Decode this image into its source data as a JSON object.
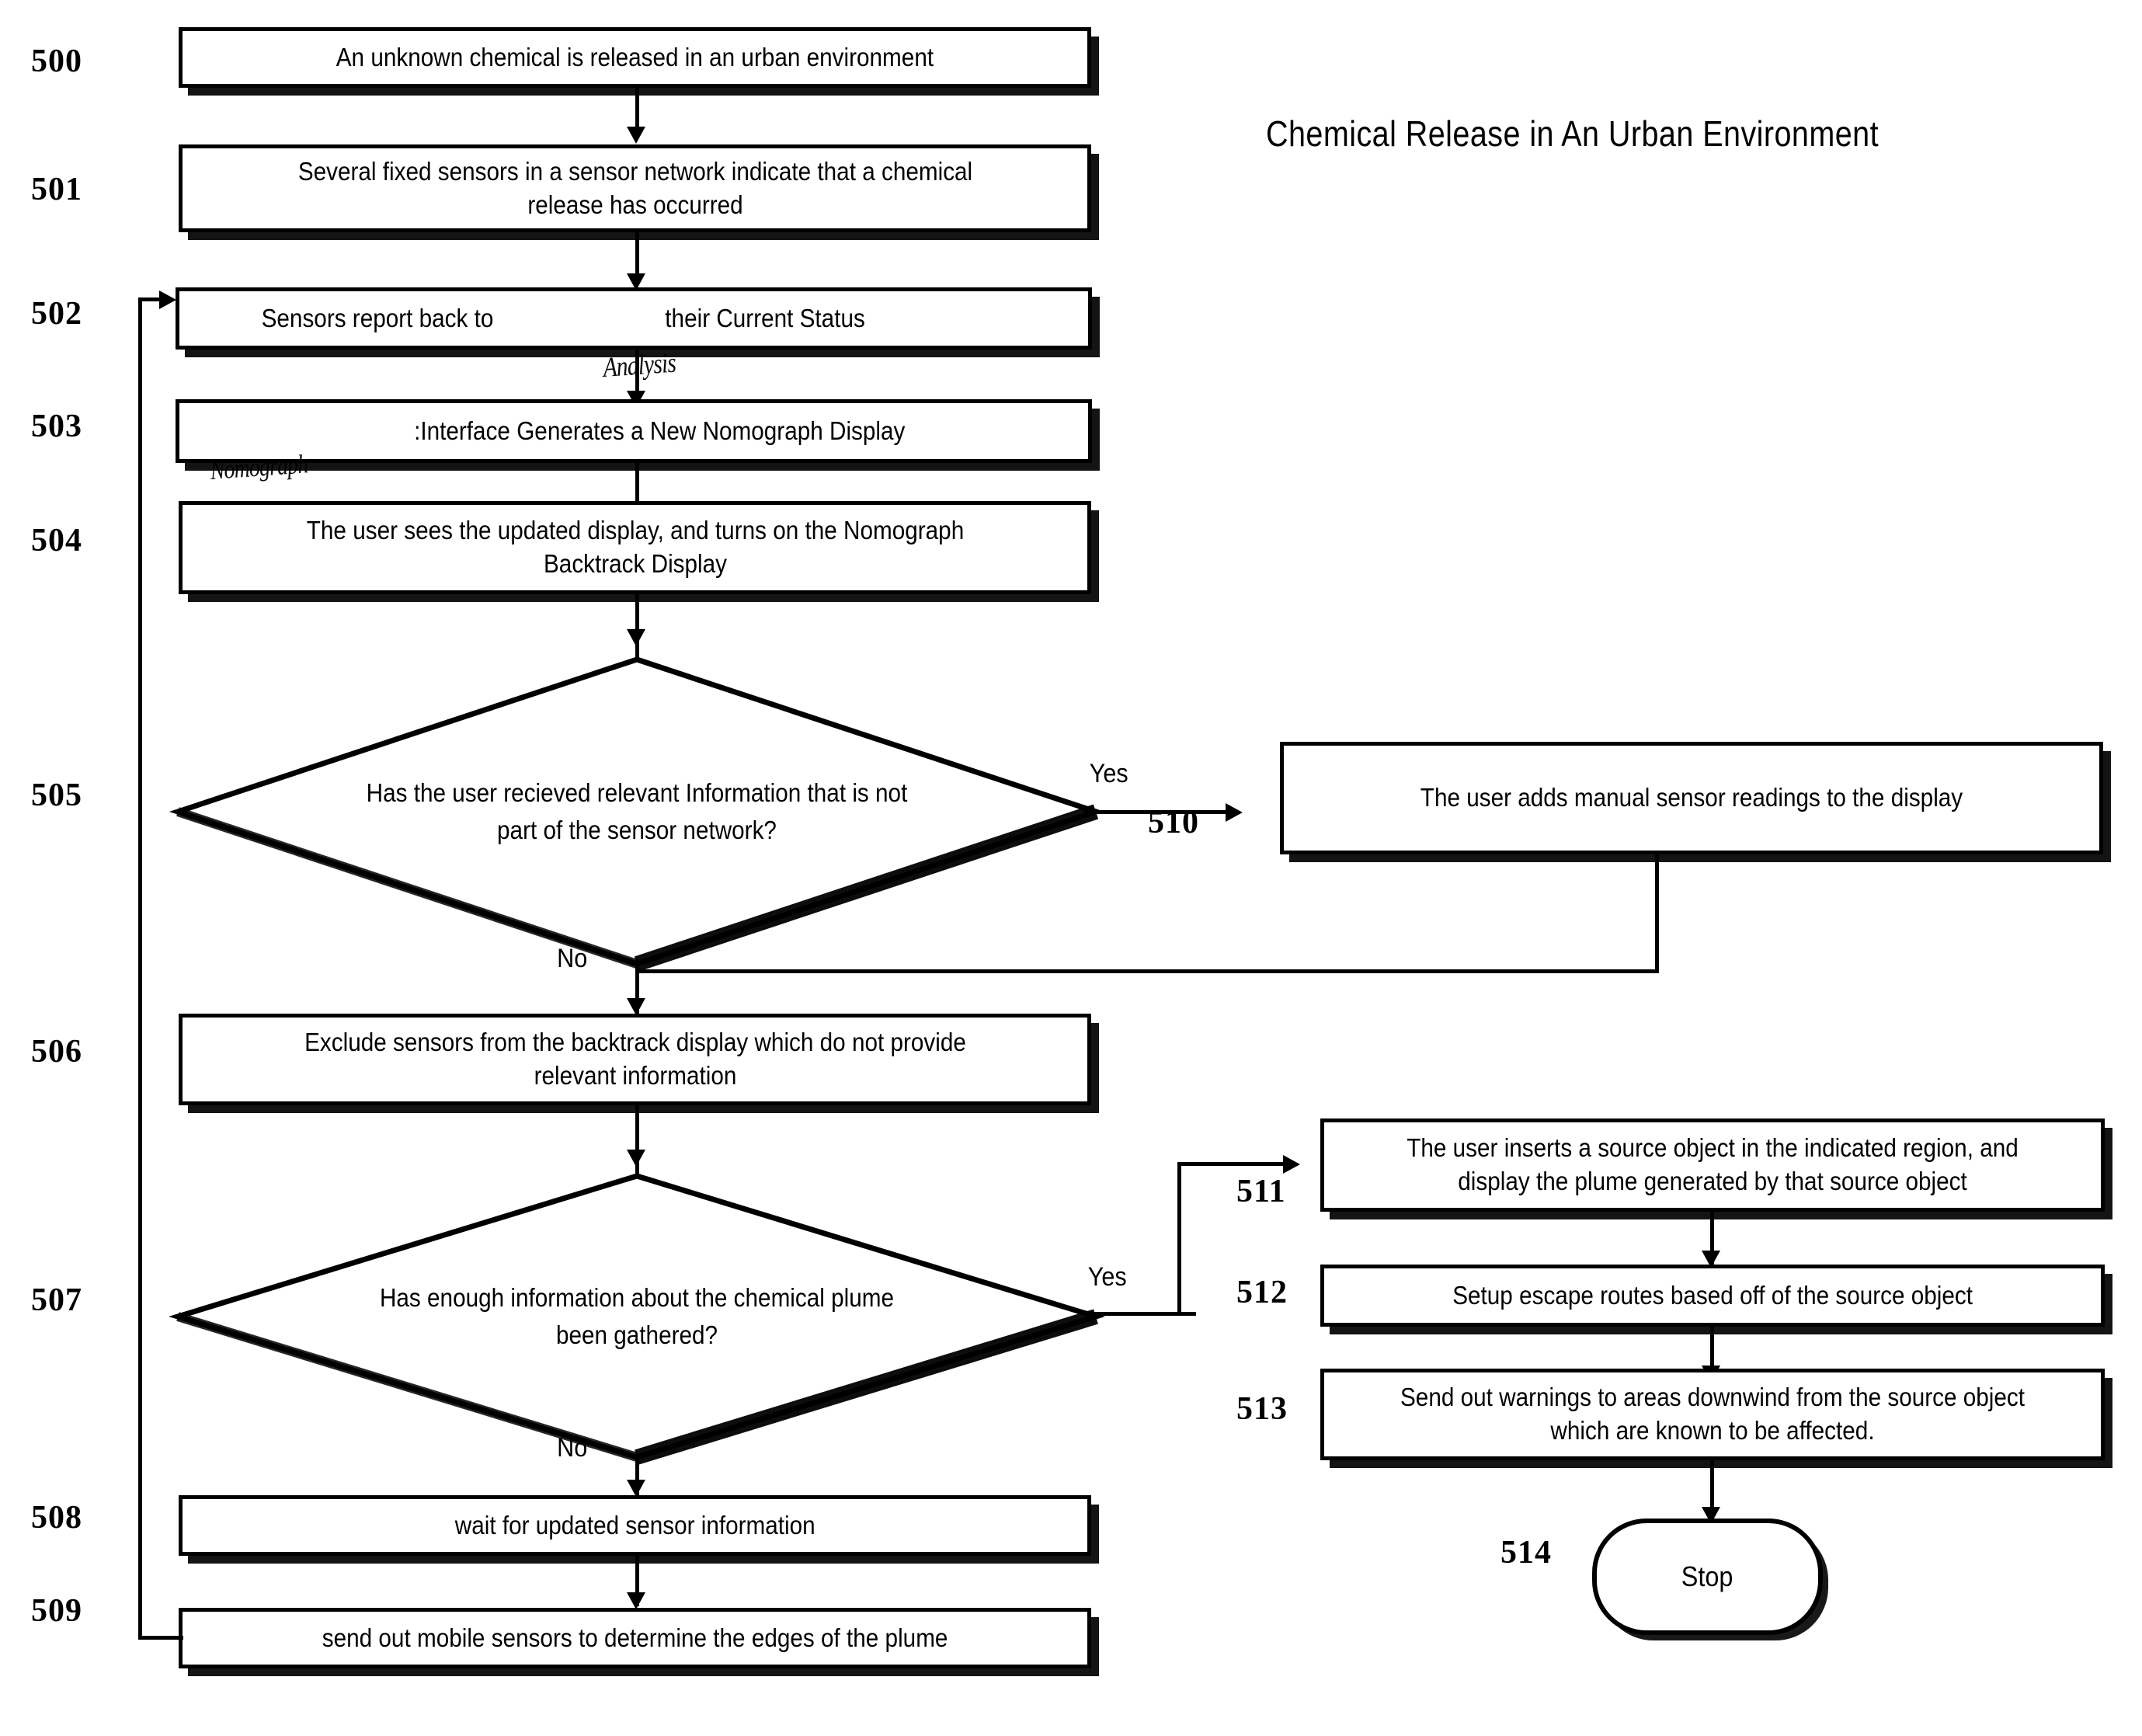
{
  "figure": {
    "title": "Chemical Release in An Urban Environment"
  },
  "nodes": {
    "n500": {
      "ref": "500",
      "text": "An unknown chemical is released in an urban environment",
      "type": "process"
    },
    "n501": {
      "ref": "501",
      "text": "Several fixed sensors in a sensor network indicate that a chemical release has occurred",
      "type": "process"
    },
    "n502": {
      "ref": "502",
      "text_before": "Sensors report back to",
      "text_after": "their Current Status",
      "type": "process"
    },
    "n503": {
      "ref": "503",
      "text": ":Interface Generates a New Nomograph Display",
      "type": "process"
    },
    "n504": {
      "ref": "504",
      "text": "The user sees the updated display, and turns on the Nomograph Backtrack Display",
      "type": "process"
    },
    "n505": {
      "ref": "505",
      "text": "Has the user recieved relevant Information that is not part of the sensor network?",
      "type": "decision"
    },
    "n506": {
      "ref": "506",
      "text": "Exclude sensors from the backtrack display which do not provide relevant information",
      "type": "process"
    },
    "n507": {
      "ref": "507",
      "text": "Has enough information about the chemical plume been gathered?",
      "type": "decision"
    },
    "n508": {
      "ref": "508",
      "text": "wait for updated sensor information",
      "type": "process"
    },
    "n509": {
      "ref": "509",
      "text": "send out mobile sensors to determine the edges of the plume",
      "type": "process"
    },
    "n510": {
      "ref": "510",
      "text": "The user adds manual sensor readings to the display",
      "type": "process"
    },
    "n511": {
      "ref": "511",
      "text": "The user inserts a source object in the indicated region, and display the plume generated by that source object",
      "type": "process"
    },
    "n512": {
      "ref": "512",
      "text": "Setup escape routes based off of the source object",
      "type": "process"
    },
    "n513": {
      "ref": "513",
      "text": "Send out warnings to areas downwind from the source object which are known to be affected.",
      "type": "process"
    },
    "n514": {
      "ref": "514",
      "text": "Stop",
      "type": "terminator"
    }
  },
  "branch_labels": {
    "yes_505": "Yes",
    "no_505": "No",
    "yes_507": "Yes",
    "no_507": "No"
  },
  "annotations": {
    "hw_analysis": "Analysis",
    "hw_nomograph": "Nomograph"
  }
}
